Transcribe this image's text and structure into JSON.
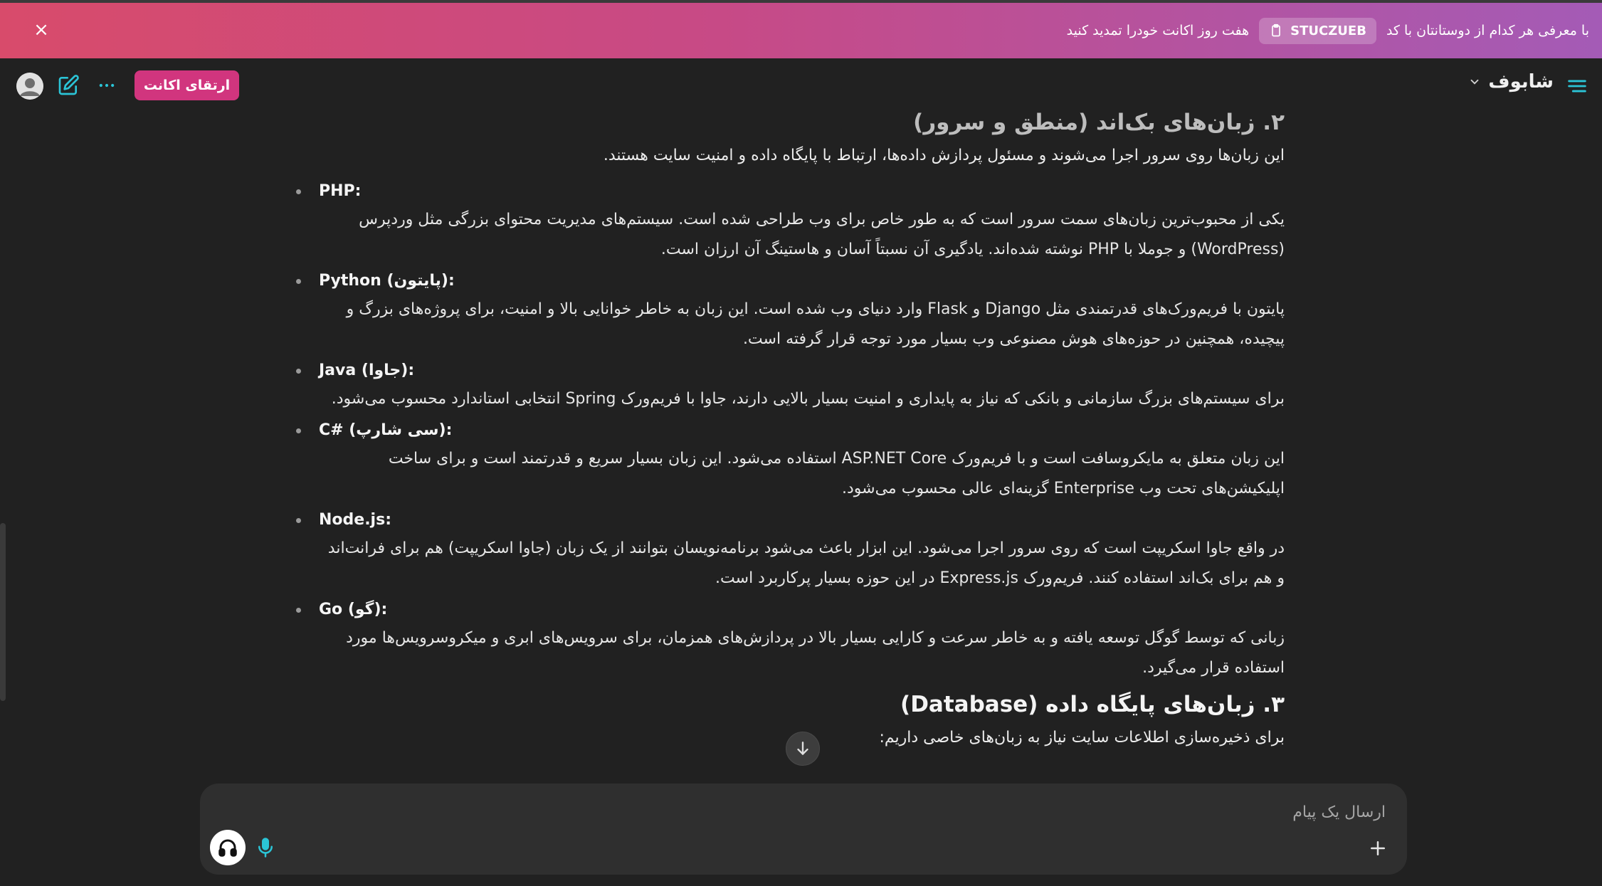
{
  "banner": {
    "text_before": "با معرفی هر کدام از دوستانتان با کد",
    "code": "STUCZUEB",
    "text_after": "هفت روز اکانت خودرا تمدید کنید",
    "close": "×"
  },
  "header": {
    "brand": "شابوف",
    "upgrade_label": "ارتقای اکانت"
  },
  "content": {
    "section2_title": "۲. زبان‌های بک‌اند (منطق و سرور)",
    "section2_intro": "این زبان‌ها روی سرور اجرا می‌شوند و مسئول پردازش داده‌ها، ارتباط با پایگاه داده و امنیت سایت هستند.",
    "items": [
      {
        "title": "PHP:",
        "body": "یکی از محبوب‌ترین زبان‌های سمت سرور است که به طور خاص برای وب طراحی شده است. سیستم‌های مدیریت محتوای بزرگی مثل وردپرس (WordPress) و جوملا با PHP نوشته شده‌اند. یادگیری آن نسبتاً آسان و هاستینگ آن ارزان است."
      },
      {
        "title": "Python (پایتون):",
        "body": "پایتون با فریم‌ورک‌های قدرتمندی مثل Django و Flask وارد دنیای وب شده است. این زبان به خاطر خوانایی بالا و امنیت، برای پروژه‌های بزرگ و پیچیده، همچنین در حوزه‌های هوش مصنوعی وب بسیار مورد توجه قرار گرفته است."
      },
      {
        "title": "Java (جاوا):",
        "body": "برای سیستم‌های بزرگ سازمانی و بانکی که نیاز به پایداری و امنیت بسیار بالایی دارند، جاوا با فریم‌ورک Spring انتخابی استاندارد محسوب می‌شود."
      },
      {
        "title": "C# (سی شارپ):",
        "body": "این زبان متعلق به مایکروسافت است و با فریم‌ورک ASP.NET Core استفاده می‌شود. این زبان بسیار سریع و قدرتمند است و برای ساخت اپلیکیشن‌های تحت وب Enterprise گزینه‌ای عالی محسوب می‌شود."
      },
      {
        "title": "Node.js:",
        "body": "در واقع جاوا اسکریپت است که روی سرور اجرا می‌شود. این ابزار باعث می‌شود برنامه‌نویسان بتوانند از یک زبان (جاوا اسکریپت) هم برای فرانت‌اند و هم برای بک‌اند استفاده کنند. فریم‌ورک Express.js در این حوزه بسیار پرکاربرد است."
      },
      {
        "title": "Go (گو):",
        "body": "زبانی که توسط گوگل توسعه یافته و به خاطر سرعت و کارایی بسیار بالا در پردازش‌های همزمان، برای سرویس‌های ابری و میکروسرویس‌ها مورد استفاده قرار می‌گیرد."
      }
    ],
    "section3_title": "۳. زبان‌های پایگاه داده (Database)",
    "section3_intro": "برای ذخیره‌سازی اطلاعات سایت نیاز به زبان‌های خاصی داریم:"
  },
  "composer": {
    "placeholder": "ارسال یک پیام"
  },
  "colors": {
    "accent": "#d1357e",
    "menu_icon": "#2bc4d6",
    "mic_icon": "#2bc4d6",
    "background": "#212121",
    "composer_bg": "#2f2f2f"
  },
  "icons": {
    "menu": "menu-icon",
    "chevron": "chevron-down-icon",
    "more": "more-horizontal-icon",
    "edit": "edit-icon",
    "avatar": "user-icon",
    "copy": "clipboard-icon",
    "scroll": "arrow-down-icon",
    "plus": "plus-icon",
    "mic": "mic-icon",
    "headphones": "headphones-icon"
  }
}
